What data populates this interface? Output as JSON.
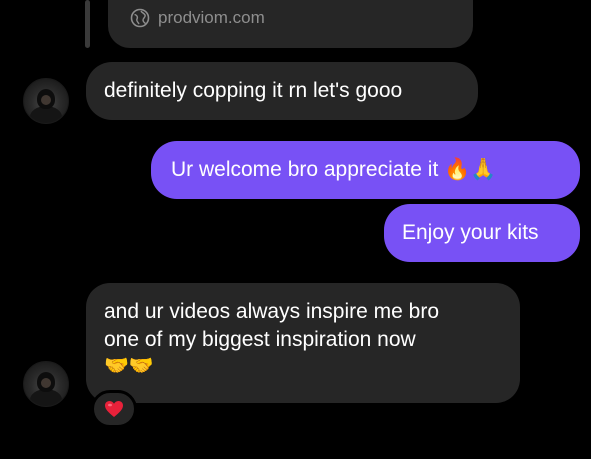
{
  "link_preview": {
    "domain": "prodviom.com",
    "icon": "globe-icon"
  },
  "messages": [
    {
      "direction": "incoming",
      "text": "definitely copping it rn let's gooo"
    },
    {
      "direction": "outgoing",
      "text": "Ur welcome bro appreciate it 🔥🙏"
    },
    {
      "direction": "outgoing",
      "text": "Enjoy your kits"
    },
    {
      "direction": "incoming",
      "lines": [
        "and ur videos always inspire me bro",
        "one of my biggest inspiration now",
        "🤝🤝"
      ]
    }
  ],
  "reaction": {
    "icon": "heart-icon",
    "emoji": "❤️"
  },
  "colors": {
    "background": "#000000",
    "incoming_bubble": "#262626",
    "outgoing_bubble": "#7851f5",
    "link_text": "#8e8e8e",
    "heart": "#e8213a"
  }
}
